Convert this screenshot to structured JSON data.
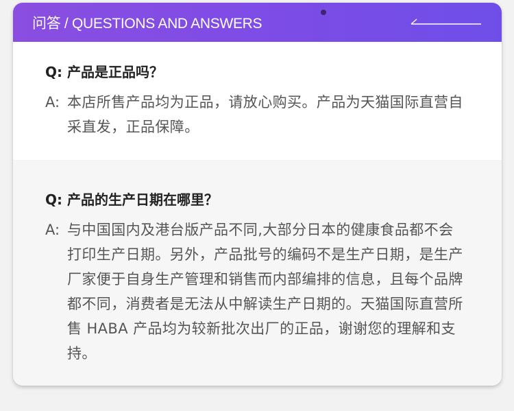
{
  "header": {
    "title": "问答 / QUESTIONS AND ANSWERS"
  },
  "qa": [
    {
      "question": "Q: 产品是正品吗？",
      "answer_prefix": "A:",
      "answer": "本店所售产品均为正品，请放心购买。产品为天猫国际直营自采直发，正品保障。"
    },
    {
      "question": "Q: 产品的生产日期在哪里？",
      "answer_prefix": "A:",
      "answer": "与中国国内及港台版产品不同,大部分日本的健康食品都不会打印生产日期。另外，产品批号的编码不是生产日期，是生产厂家便于自身生产管理和销售而内部编排的信息，且每个品牌都不同，消费者是无法从中解读生产日期的。天猫国际直营所售 HABA 产品均为较新批次出厂的正品，谢谢您的理解和支持。"
    }
  ]
}
